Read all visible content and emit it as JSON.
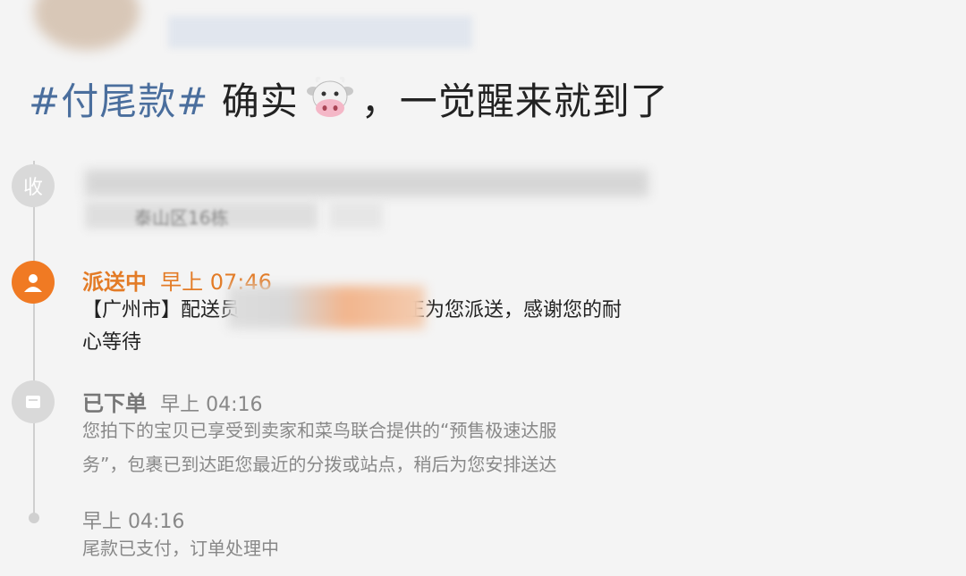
{
  "post": {
    "hashtag": "#付尾款#",
    "text_before_emoji": " 确实",
    "emoji_name": "cow-face-emoji",
    "text_after_emoji": "，一觉醒来就到了"
  },
  "timeline": {
    "first_node_icon": "收",
    "first_address_partial": "泰山区16栋",
    "events": [
      {
        "status": "派送中",
        "time": "早上 07:46",
        "desc_line1_prefix": "【广州市】配送员",
        "desc_line1_suffix": "正为您派送，感谢您的耐",
        "desc_line2": "心等待"
      },
      {
        "status": "已下单",
        "time": "早上 04:16",
        "desc_line1": "您拍下的宝贝已享受到卖家和菜鸟联合提供的“预售极速达服",
        "desc_line2": "务”，包裹已到达距您最近的分拨或站点，稍后为您安排送达"
      },
      {
        "status": "",
        "time": "早上 04:16",
        "desc_line1": "尾款已支付，订单处理中"
      }
    ]
  },
  "colors": {
    "accent_orange": "#e37b26",
    "hashtag_blue": "#4a6e9d"
  }
}
